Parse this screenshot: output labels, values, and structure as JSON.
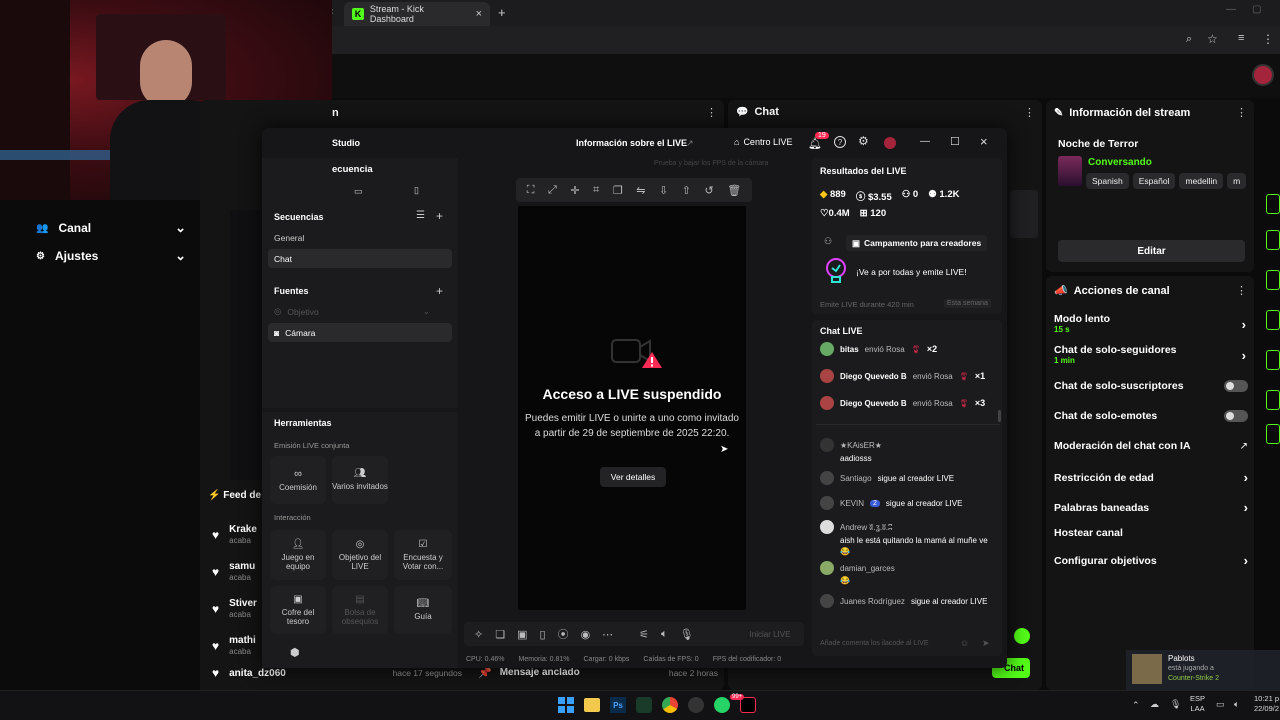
{
  "browser": {
    "tab_title": "Stream - Kick Dashboard",
    "new_tab": "+",
    "close": "×"
  },
  "side_menu": {
    "items": [
      {
        "label": "Canal",
        "icon": "users-icon"
      },
      {
        "label": "Ajustes",
        "icon": "gear-icon"
      }
    ]
  },
  "panels": {
    "left_partial_title": "n",
    "chat_title": "Chat",
    "stream_info_title": "Información del stream",
    "channel_actions_title": "Acciones de canal"
  },
  "feed": {
    "title": "Feed de",
    "rows": [
      {
        "name": "Krake",
        "sub": "acaba"
      },
      {
        "name": "samu",
        "sub": "acaba"
      },
      {
        "name": "Stiver",
        "sub": "acaba"
      },
      {
        "name": "mathi",
        "sub": "acaba"
      },
      {
        "name": "anita_dz060",
        "time": "hace 17 segundos"
      }
    ]
  },
  "pinned": {
    "label": "Mensaje anclado",
    "time": "hace 2 horas"
  },
  "stream_info": {
    "title": "Noche de Terror",
    "category": "Conversando",
    "tags": [
      "Spanish",
      "Español",
      "medellin",
      "m"
    ],
    "edit_button": "Editar"
  },
  "channel_actions": [
    {
      "label": "Modo lento",
      "sub": "15 s",
      "control": "chevron"
    },
    {
      "label": "Chat de solo-seguidores",
      "sub": "1 min",
      "control": "chevron"
    },
    {
      "label": "Chat de solo-suscriptores",
      "control": "toggle"
    },
    {
      "label": "Chat de solo-emotes",
      "control": "toggle"
    },
    {
      "label": "Moderación del chat con IA",
      "control": "external"
    },
    {
      "label": "Restricción de edad",
      "control": "chevron"
    },
    {
      "label": "Palabras baneadas",
      "control": "chevron"
    },
    {
      "label": "Hostear canal",
      "control": "none"
    },
    {
      "label": "Configurar objetivos",
      "control": "chevron"
    }
  ],
  "studio": {
    "title": "Studio",
    "live_info": "Información sobre el LIVE",
    "centro_live": "Centro LIVE",
    "notif_count": "19",
    "fps_hint": "Prueba y bajar los FPS de la cámara",
    "sequence_header": "ecuencia",
    "sequences_title": "Secuencias",
    "sequences": [
      "General",
      "Chat"
    ],
    "sources_title": "Fuentes",
    "sources": [
      {
        "label": "Objetivo",
        "disabled": true
      },
      {
        "label": "Cámara",
        "disabled": false
      }
    ],
    "tools_title": "Herramientas",
    "coop_label": "Emisión LIVE conjunta",
    "coop_buttons": [
      "Coemisión",
      "Varios invitados"
    ],
    "interaction_label": "Interacción",
    "interaction_buttons": [
      {
        "label": "Juego en equipo",
        "disabled": false
      },
      {
        "label": "Objetivo del LIVE",
        "disabled": false
      },
      {
        "label": "Encuesta y Votar con...",
        "disabled": false
      },
      {
        "label": "Cofre del tesoro",
        "disabled": false
      },
      {
        "label": "Bolsa de obsequios",
        "disabled": true
      },
      {
        "label": "Guía",
        "disabled": false
      }
    ],
    "preview": {
      "heading": "Acceso a LIVE suspendido",
      "body": "Puedes emitir LIVE o unirte a uno como invitado a partir de 29 de septiembre de 2025 22:20.",
      "button": "Ver detalles"
    },
    "start_live": "Iniciar LIVE",
    "stats_bar": {
      "cpu": "CPU: 0.46%",
      "mem": "Memoria: 0.81%",
      "load": "Cargar: 0 kbps",
      "fps_drops": "Caídas de FPS: 0",
      "encoder": "FPS del codificador: 0"
    },
    "results": {
      "title": "Resultados del LIVE",
      "coins": "889",
      "money": "$3.55",
      "new_followers": "0",
      "viewers": "1.2K",
      "likes": "0.4M",
      "gifts": "120",
      "campaign": "Campamento para creadores",
      "promo": "¡Ve a por todas y emite LIVE!",
      "goal": "Emite LIVE durante 420 min",
      "goal_period": "Esta semana"
    },
    "chat_live": {
      "title": "Chat LIVE",
      "gifts": [
        {
          "user": "bitas",
          "action": "envió Rosa",
          "count": "×2"
        },
        {
          "user": "Diego Quevedo B",
          "action": "envió Rosa",
          "count": "×1"
        },
        {
          "user": "Diego Quevedo B",
          "action": "envió Rosa",
          "count": "×3"
        }
      ],
      "messages": [
        {
          "user": "★KAisER★",
          "text": "aadiosss"
        },
        {
          "user": "Santiago",
          "text": "sigue al creador LIVE"
        },
        {
          "user": "KEVIN",
          "badge": "2",
          "text": "sigue al creador LIVE"
        },
        {
          "user": "Andrew ʬ.ʓ.ʬ.ʭ",
          "text": "aish le está quitando la mamá al muñe ve 😂"
        },
        {
          "user": "damian_garces",
          "text": "😂"
        },
        {
          "user": "Juanes Rodríguez",
          "text": "sigue al creador LIVE"
        }
      ],
      "input_placeholder": "Añade comenta los ilacode al LIVE"
    }
  },
  "chat_send": "Chat",
  "notification": {
    "user": "Pablots",
    "line1": "está jugando a",
    "game": "Counter-Strike 2"
  },
  "taskbar": {
    "lang": "ESP",
    "region": "LAA",
    "time": "10:21 p",
    "date": "22/09/2",
    "badge": "99+"
  },
  "colors": {
    "accent": "#53fc18",
    "danger": "#ff2b55",
    "bg": "#0b0b0c"
  }
}
